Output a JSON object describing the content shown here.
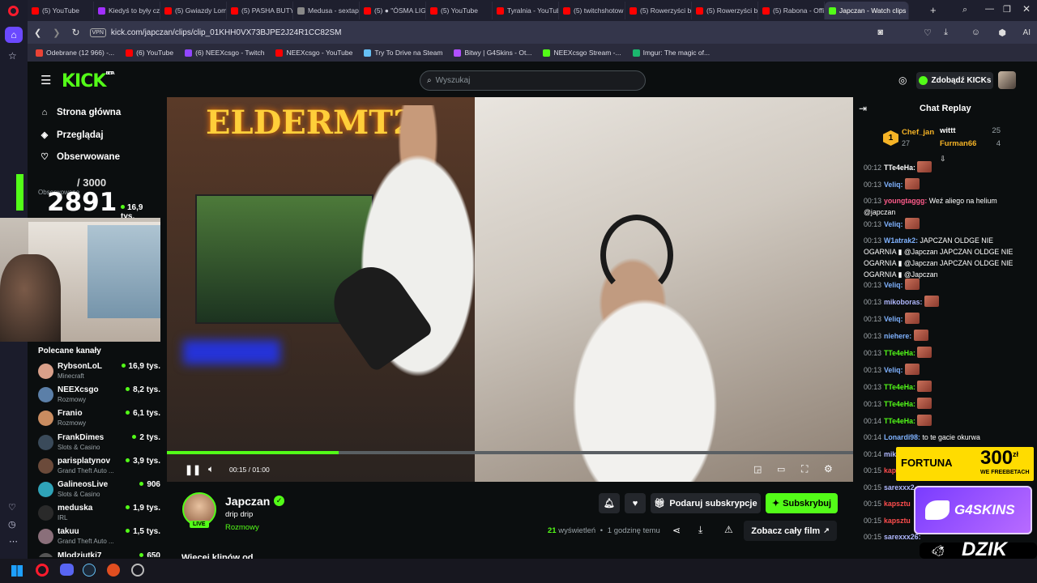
{
  "tabs": [
    {
      "title": "(5) YouTube",
      "color": "#ff0000"
    },
    {
      "title": "Kiedyś to były cza",
      "color": "#a12fff"
    },
    {
      "title": "(5) Gwiazdy Lomb",
      "color": "#ff0000"
    },
    {
      "title": "(5) PASHA BUTY 2",
      "color": "#ff0000"
    },
    {
      "title": "Medusa - sextape",
      "color": "#888888"
    },
    {
      "title": "(5) ● \"ÓSMA LIG",
      "color": "#ff0000"
    },
    {
      "title": "(5) YouTube",
      "color": "#ff0000"
    },
    {
      "title": "Tyralnia - YouTub",
      "color": "#ff0000"
    },
    {
      "title": "(5) twitchshotow",
      "color": "#ff0000"
    },
    {
      "title": "(5) Rowerzyści bie",
      "color": "#ff0000"
    },
    {
      "title": "(5) Rowerzyści bie",
      "color": "#ff0000"
    },
    {
      "title": "(5) Rabona - Offic",
      "color": "#ff0000"
    },
    {
      "title": "Japczan - Watch clips",
      "color": "#53fc18",
      "active": true
    }
  ],
  "address": {
    "vpn": "VPN",
    "url": "kick.com/japczan/clips/clip_01KHH0VX73BJPE2J24R1CC82SM",
    "ai": "AI"
  },
  "bookmarks": [
    {
      "label": "Odebrane (12 966) -...",
      "color": "#ea4335"
    },
    {
      "label": "(6) YouTube",
      "color": "#ff0000"
    },
    {
      "label": "(6) NEEXcsgo - Twitch",
      "color": "#9146ff"
    },
    {
      "label": "NEEXcsgo - YouTube",
      "color": "#ff0000"
    },
    {
      "label": "Try To Drive na Steam",
      "color": "#66c0f4"
    },
    {
      "label": "Bitwy | G4Skins - Ot...",
      "color": "#b050ff"
    },
    {
      "label": "NEEXcsgo Stream -...",
      "color": "#53fc18"
    },
    {
      "label": "Imgur: The magic of...",
      "color": "#1bb76e"
    }
  ],
  "kick": {
    "logo": "KICK",
    "logo_beta": "BETA",
    "search_placeholder": "Wyszukaj",
    "get_kicks": "Zdobądź KICKs",
    "nav": [
      "Strona główna",
      "Przeglądaj",
      "Obserwowane"
    ],
    "recommended_title": "Polecane kanały",
    "recommended": [
      {
        "name": "RybsonLoL",
        "category": "Minecraft",
        "viewers": "16,9 tys.",
        "color": "#d9a08a"
      },
      {
        "name": "NEEXcsgo",
        "category": "Rozmowy",
        "viewers": "8,2 tys.",
        "color": "#5b7fa8"
      },
      {
        "name": "Franio",
        "category": "Rozmowy",
        "viewers": "6,1 tys.",
        "color": "#c98c60"
      },
      {
        "name": "FrankDimes",
        "category": "Slots & Casino",
        "viewers": "2 tys.",
        "color": "#3a4a5a"
      },
      {
        "name": "parisplatynov",
        "category": "Grand Theft Auto ...",
        "viewers": "3,9 tys.",
        "color": "#6b4a3a"
      },
      {
        "name": "GalinеosLive",
        "category": "Slots & Casino",
        "viewers": "906",
        "color": "#2fa3b8"
      },
      {
        "name": "meduska",
        "category": "IRL",
        "viewers": "1,9 tys.",
        "color": "#2a2a2a"
      },
      {
        "name": "takuu",
        "category": "Grand Theft Auto ...",
        "viewers": "1,5 tys.",
        "color": "#8a6f7a"
      },
      {
        "name": "Mlodziutki7",
        "category": "",
        "viewers": "650",
        "color": "#555555"
      }
    ],
    "overlay_followed": "Obserwowane",
    "overlay_followed_viewers": "16,9 tys.",
    "sub_goal": "/ 3000",
    "sub_count": "2891"
  },
  "player": {
    "time_current": "00:15",
    "time_sep": "/",
    "time_total": "01:00",
    "progress": 0.25
  },
  "video_sign": "ELDERMT2",
  "stream_info": {
    "channel": "Japczan",
    "title": "drip drip",
    "category": "Rozmowy",
    "live": "LIVE",
    "gift_btn": "Podaruj subskrypcje",
    "sub_btn": "Subskrybuj",
    "views_count": "21",
    "views_label": "wyświetleń",
    "time_ago": "1 godzinę temu",
    "watch_full": "Zobacz cały film",
    "more": "Więcej klipów od..."
  },
  "chat": {
    "title": "Chat Replay",
    "top": [
      {
        "name": "Chef_jan",
        "count": "27",
        "rank": "1"
      },
      {
        "name": "wittt",
        "count": "25"
      },
      {
        "name": "Furman66",
        "count": "4"
      }
    ],
    "messages": [
      {
        "time": "00:12",
        "user": "TTe4eHa:",
        "color": "#ffffff",
        "text": "",
        "emote": true
      },
      {
        "time": "00:13",
        "user": "Veliq:",
        "color": "#7fb2ff",
        "text": "",
        "emote": true
      },
      {
        "time": "00:13",
        "user": "youngtaggg:",
        "color": "#ff5b8a",
        "text": "Weź aliego na helium @japczan",
        "emote": false
      },
      {
        "time": "00:13",
        "user": "Veliq:",
        "color": "#7fb2ff",
        "text": "",
        "emote": true
      },
      {
        "time": "00:13",
        "user": "W1atrak2:",
        "color": "#7fb2ff",
        "text": "JAPCZAN OLDGE NIE OGARNIA ▮ @Japczan JAPCZAN OLDGE NIE OGARNIA ▮ @Japczan JAPCZAN OLDGE NIE OGARNIA ▮ @Japczan",
        "emote": false
      },
      {
        "time": "00:13",
        "user": "Veliq:",
        "color": "#7fb2ff",
        "text": "",
        "emote": true
      },
      {
        "time": "00:13",
        "user": "mikoboras:",
        "color": "#b0b8ff",
        "text": "",
        "emote": true
      },
      {
        "time": "00:13",
        "user": "Veliq:",
        "color": "#7fb2ff",
        "text": "",
        "emote": true
      },
      {
        "time": "00:13",
        "user": "niehere:",
        "color": "#7fb2ff",
        "text": "",
        "emote": true
      },
      {
        "time": "00:13",
        "user": "TTe4eHa:",
        "color": "#53fc18",
        "text": "",
        "emote": true
      },
      {
        "time": "00:13",
        "user": "Veliq:",
        "color": "#7fb2ff",
        "text": "",
        "emote": true
      },
      {
        "time": "00:13",
        "user": "TTe4eHa:",
        "color": "#53fc18",
        "text": "",
        "emote": true
      },
      {
        "time": "00:13",
        "user": "TTe4eHa:",
        "color": "#53fc18",
        "text": "",
        "emote": true
      },
      {
        "time": "00:14",
        "user": "TTe4eHa:",
        "color": "#53fc18",
        "text": "",
        "emote": true
      },
      {
        "time": "00:14",
        "user": "Lonardi98:",
        "color": "#7fb2ff",
        "text": "to te gacie okurwa",
        "emote": false
      },
      {
        "time": "00:14",
        "user": "miko",
        "color": "#b0b8ff",
        "text": "",
        "emote": false
      },
      {
        "time": "00:15",
        "user": "kapsz",
        "color": "#ff4d4d",
        "text": "",
        "emote": false
      },
      {
        "time": "00:15",
        "user": "sarexxx2",
        "color": "#b0b8ff",
        "text": "",
        "emote": false
      },
      {
        "time": "00:15",
        "user": "kapsztu",
        "color": "#ff4d4d",
        "text": "",
        "emote": false
      },
      {
        "time": "00:15",
        "user": "kapsztu",
        "color": "#ff4d4d",
        "text": "",
        "emote": false
      },
      {
        "time": "00:15",
        "user": "sarexxx26:",
        "color": "#b0b8ff",
        "text": "",
        "emote": false
      }
    ]
  },
  "ads": {
    "fortuna": "FORTUNA",
    "fortuna_amount": "300",
    "fortuna_unit": "zł",
    "fortuna_sub": "WE FREEBETACH",
    "g4skins": "G4SKINS",
    "dzik": "DZIK"
  }
}
